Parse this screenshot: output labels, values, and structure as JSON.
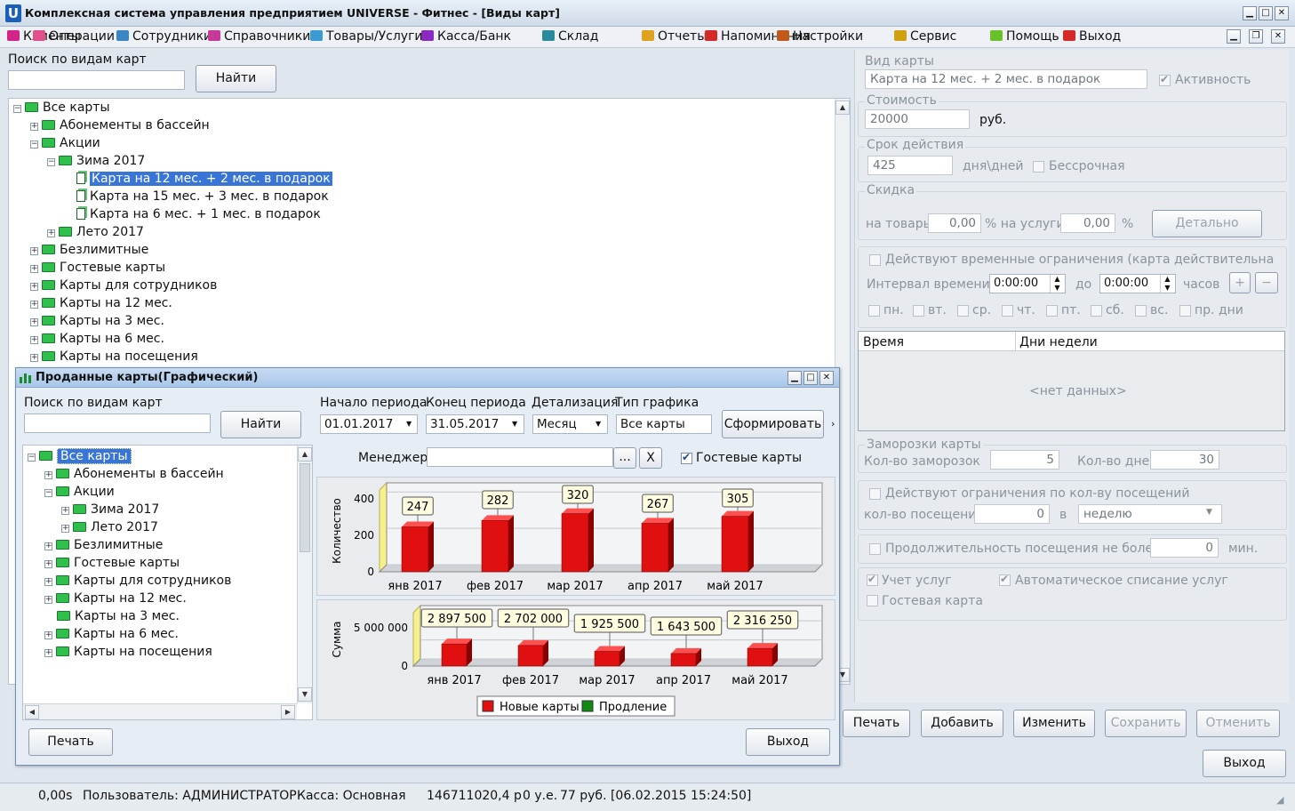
{
  "window": {
    "title": "Комплексная система управления предприятием UNIVERSE - Фитнес - [Виды карт]",
    "app_letter": "U"
  },
  "menu": [
    {
      "label": "Клиенты",
      "color": "#d4268a"
    },
    {
      "label": "Операции",
      "color": "#e0508a"
    },
    {
      "label": "Сотрудники",
      "color": "#3a86c8"
    },
    {
      "label": "Справочники",
      "color": "#c83a9a"
    },
    {
      "label": "Товары/Услуги",
      "color": "#3a9ad4"
    },
    {
      "label": "Касса/Банк",
      "color": "#8a2ac0"
    },
    {
      "label": "Склад",
      "color": "#2a8a9a"
    },
    {
      "label": "Отчеты",
      "color": "#e0a020"
    },
    {
      "label": "Напоминания",
      "color": "#d42a2a"
    },
    {
      "label": "Настройки",
      "color": "#c05a1a"
    },
    {
      "label": "Сервис",
      "color": "#d0a010"
    },
    {
      "label": "Помощь",
      "color": "#6ac02a"
    },
    {
      "label": "Выход",
      "color": "#d42a2a"
    }
  ],
  "left": {
    "search_label": "Поиск по видам карт",
    "search_value": "",
    "find_button": "Найти",
    "tree": [
      {
        "label": "Все карты",
        "level": 0,
        "exp": "−",
        "icon": "folder"
      },
      {
        "label": "Абонементы в бассейн",
        "level": 1,
        "exp": "+",
        "icon": "folder"
      },
      {
        "label": "Акции",
        "level": 1,
        "exp": "−",
        "icon": "folder"
      },
      {
        "label": "Зима 2017",
        "level": 2,
        "exp": "−",
        "icon": "folder"
      },
      {
        "label": "Карта на 12 мес. + 2 мес. в подарок",
        "level": 3,
        "exp": "",
        "icon": "card",
        "selected": true
      },
      {
        "label": "Карта на 15 мес. + 3 мес. в подарок",
        "level": 3,
        "exp": "",
        "icon": "card"
      },
      {
        "label": "Карта на 6 мес. + 1 мес. в подарок",
        "level": 3,
        "exp": "",
        "icon": "card"
      },
      {
        "label": "Лето 2017",
        "level": 2,
        "exp": "+",
        "icon": "folder"
      },
      {
        "label": "Безлимитные",
        "level": 1,
        "exp": "+",
        "icon": "folder"
      },
      {
        "label": "Гостевые карты",
        "level": 1,
        "exp": "+",
        "icon": "folder"
      },
      {
        "label": "Карты для сотрудников",
        "level": 1,
        "exp": "+",
        "icon": "folder"
      },
      {
        "label": "Карты на 12 мес.",
        "level": 1,
        "exp": "+",
        "icon": "folder"
      },
      {
        "label": "Карты на 3 мес.",
        "level": 1,
        "exp": "+",
        "icon": "folder"
      },
      {
        "label": "Карты на 6 мес.",
        "level": 1,
        "exp": "+",
        "icon": "folder"
      },
      {
        "label": "Карты на посещения",
        "level": 1,
        "exp": "+",
        "icon": "folder"
      }
    ]
  },
  "right": {
    "card_type_label": "Вид карты",
    "card_type_value": "Карта на 12 мес. + 2 мес. в подарок",
    "active_label": "Активность",
    "cost_label": "Стоимость",
    "cost_value": "20000",
    "cost_unit": "руб.",
    "validity_label": "Срок действия",
    "validity_value": "425",
    "validity_unit": "дня\\дней",
    "unlimited_label": "Бессрочная",
    "discount_label": "Скидка",
    "goods_label": "на товары",
    "goods_value": "0,00",
    "services_label": "% на услуги",
    "services_value": "0,00",
    "percent": "%",
    "detail_button": "Детально",
    "time_limit_label": "Действуют временные ограничения (карта действительна",
    "interval_label": "Интервал времени с",
    "time_from": "0:00:00",
    "to_label": "до",
    "time_to": "0:00:00",
    "hours_label": "часов",
    "days": [
      "пн.",
      "вт.",
      "ср.",
      "чт.",
      "пт.",
      "сб.",
      "вс.",
      "пр. дни"
    ],
    "grid_col_time": "Время",
    "grid_col_days": "Дни недели",
    "no_data": "<нет данных>",
    "freeze_label": "Заморозки карты",
    "freeze_count_label": "Кол-во заморозок",
    "freeze_count": "5",
    "freeze_days_label": "Кол-во дней",
    "freeze_days": "30",
    "visit_limit_label": "Действуют ограничения по кол-ву посещений",
    "visit_count_label": "кол-во посещений",
    "visit_count": "0",
    "in_label": "в",
    "period_value": "неделю",
    "duration_label": "Продолжительность посещения не более",
    "duration_value": "0",
    "min_label": "мин.",
    "service_account_label": "Учет услуг",
    "auto_writeoff_label": "Автоматическое списание услуг",
    "guest_card_label": "Гостевая карта",
    "print_button": "Печать",
    "add_button": "Добавить",
    "edit_button": "Изменить",
    "save_button": "Сохранить",
    "cancel_button": "Отменить",
    "exit_button": "Выход"
  },
  "sub": {
    "title": "Проданные карты(Графический)",
    "search_label": "Поиск по видам карт",
    "find_button": "Найти",
    "period_start_label": "Начало периода",
    "period_start": "01.01.2017",
    "period_end_label": "Конец периода",
    "period_end": "31.05.2017",
    "detail_label": "Детализация",
    "detail_value": "Месяц",
    "chart_type_label": "Тип графика",
    "chart_type_value": "Все карты",
    "build_button": "Сформировать",
    "manager_label": "Менеджер",
    "manager_value": "",
    "dots_button": "...",
    "x_button": "X",
    "guest_cards_label": "Гостевые карты",
    "print_button": "Печать",
    "exit_button": "Выход",
    "tree": [
      {
        "label": "Все карты",
        "level": 0,
        "exp": "−",
        "selected": true
      },
      {
        "label": "Абонементы в бассейн",
        "level": 1,
        "exp": "+"
      },
      {
        "label": "Акции",
        "level": 1,
        "exp": "−"
      },
      {
        "label": "Зима 2017",
        "level": 2,
        "exp": "+"
      },
      {
        "label": "Лето 2017",
        "level": 2,
        "exp": "+"
      },
      {
        "label": "Безлимитные",
        "level": 1,
        "exp": "+"
      },
      {
        "label": "Гостевые карты",
        "level": 1,
        "exp": "+"
      },
      {
        "label": "Карты для сотрудников",
        "level": 1,
        "exp": "+"
      },
      {
        "label": "Карты на 12 мес.",
        "level": 1,
        "exp": "+"
      },
      {
        "label": "Карты на 3 мес.",
        "level": 1,
        "exp": ""
      },
      {
        "label": "Карты на 6 мес.",
        "level": 1,
        "exp": "+"
      },
      {
        "label": "Карты на посещения",
        "level": 1,
        "exp": "+"
      }
    ],
    "legend": [
      {
        "label": "Новые карты",
        "color": "#e01010"
      },
      {
        "label": "Продление",
        "color": "#108a10"
      }
    ]
  },
  "chart_data": [
    {
      "type": "bar",
      "categories": [
        "янв 2017",
        "фев 2017",
        "мар 2017",
        "апр 2017",
        "май 2017"
      ],
      "series": [
        {
          "name": "Новые карты",
          "values": [
            247,
            282,
            320,
            267,
            305
          ],
          "color": "#e01010"
        }
      ],
      "ylabel": "Количество",
      "yticks": [
        "0",
        "200",
        "400"
      ],
      "ylim": [
        0,
        450
      ],
      "data_labels": [
        "247",
        "282",
        "320",
        "267",
        "305"
      ]
    },
    {
      "type": "bar",
      "categories": [
        "янв 2017",
        "фев 2017",
        "мар 2017",
        "апр 2017",
        "май 2017"
      ],
      "series": [
        {
          "name": "Новые карты",
          "values": [
            2897500,
            2702000,
            1925500,
            1643500,
            2316250
          ],
          "color": "#e01010"
        }
      ],
      "ylabel": "Сумма",
      "yticks": [
        "0",
        "5 000 000"
      ],
      "ylim": [
        0,
        7000000
      ],
      "data_labels": [
        "2 897 500",
        "2 702 000",
        "1 925 500",
        "1 643 500",
        "2 316 250"
      ]
    }
  ],
  "status": {
    "time": "0,00s",
    "user": "Пользователь: АДМИНИСТРАТОР",
    "cashbox": "Касса: Основная",
    "balance": "146711020,4 р",
    "ue": "0 у.е.",
    "last": "77 руб. [06.02.2015 15:24:50]"
  }
}
